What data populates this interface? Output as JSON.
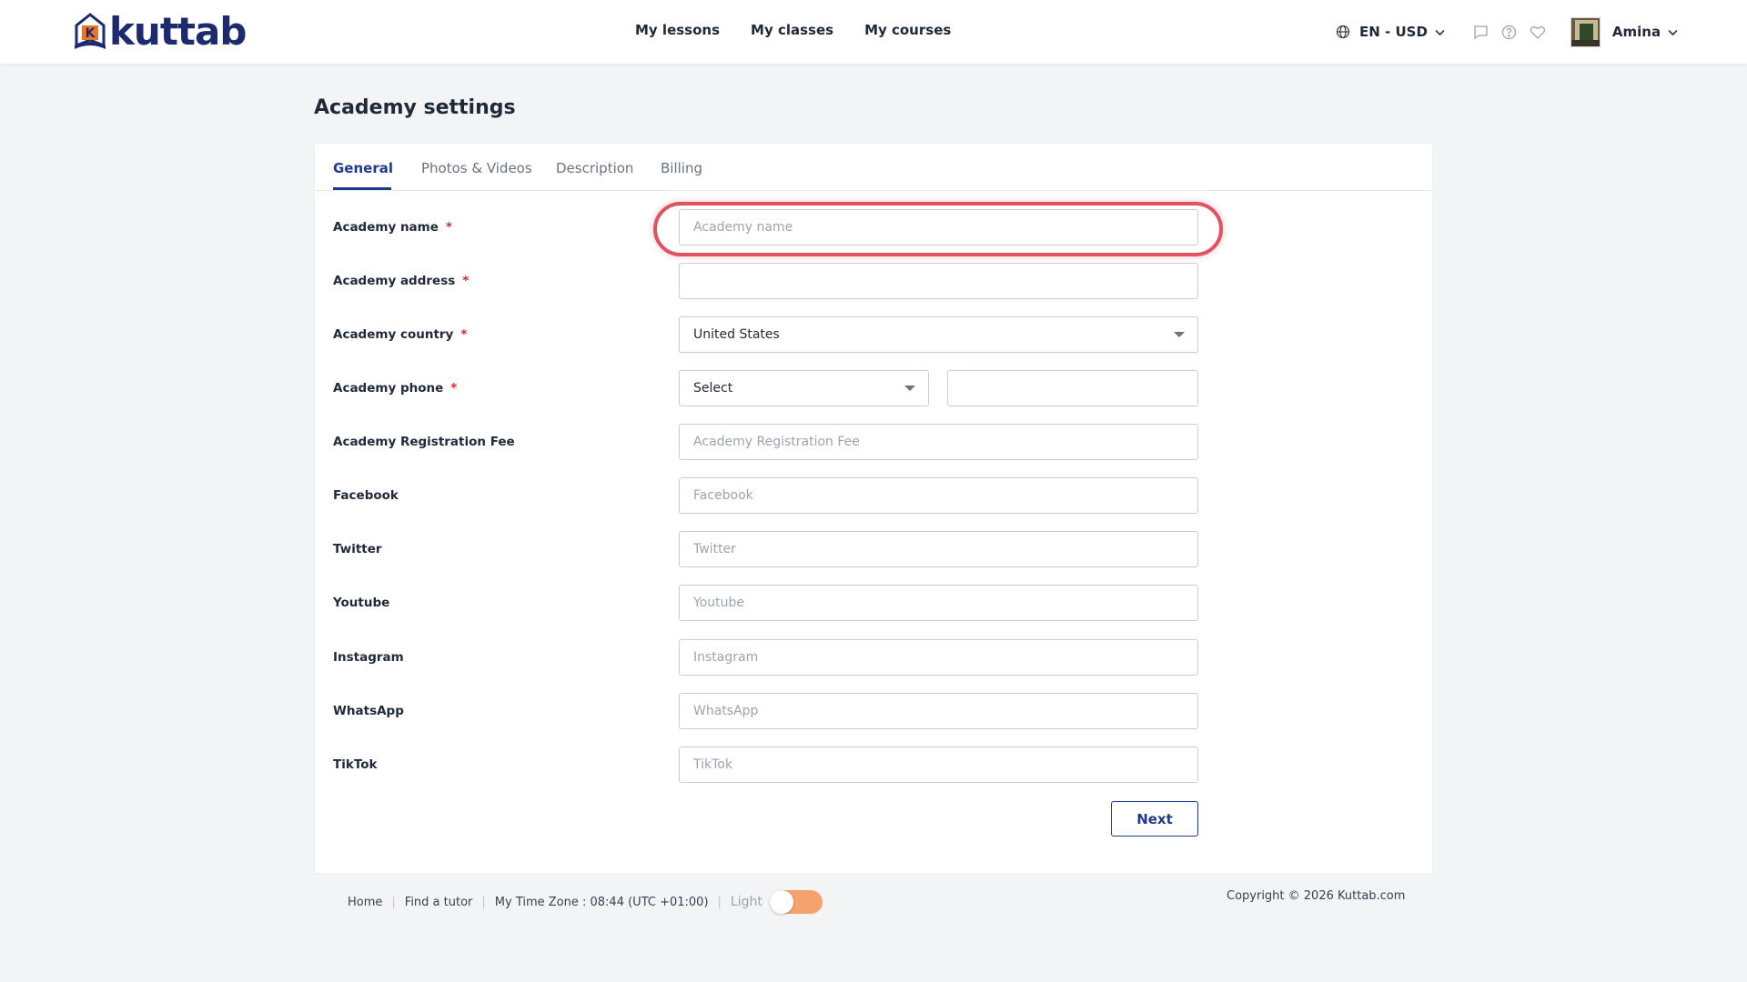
{
  "header": {
    "logo_text": "kuttab",
    "nav": [
      "My lessons",
      "My classes",
      "My courses"
    ],
    "language_currency": "EN - USD",
    "user_name": "Amina"
  },
  "page": {
    "title": "Academy settings"
  },
  "tabs": [
    "General",
    "Photos & Videos",
    "Description",
    "Billing"
  ],
  "form": {
    "academy_name": {
      "label": "Academy name",
      "required": "*",
      "placeholder": "Academy name",
      "value": ""
    },
    "academy_address": {
      "label": "Academy address",
      "required": "*",
      "placeholder": "",
      "value": ""
    },
    "academy_country": {
      "label": "Academy country",
      "required": "*",
      "value": "United States"
    },
    "academy_phone": {
      "label": "Academy phone",
      "required": "*",
      "code_value": "Select",
      "number_value": ""
    },
    "registration_fee": {
      "label": "Academy Registration Fee",
      "placeholder": "Academy Registration Fee"
    },
    "facebook": {
      "label": "Facebook",
      "placeholder": "Facebook"
    },
    "twitter": {
      "label": "Twitter",
      "placeholder": "Twitter"
    },
    "youtube": {
      "label": "Youtube",
      "placeholder": "Youtube"
    },
    "instagram": {
      "label": "Instagram",
      "placeholder": "Instagram"
    },
    "whatsapp": {
      "label": "WhatsApp",
      "placeholder": "WhatsApp"
    },
    "tiktok": {
      "label": "TikTok",
      "placeholder": "TikTok"
    },
    "next_label": "Next"
  },
  "footer": {
    "home": "Home",
    "find_tutor": "Find a tutor",
    "timezone": "My Time Zone : 08:44 (UTC +01:00)",
    "theme_label": "Light",
    "copyright": "Copyright © 2026 Kuttab.com"
  },
  "colors": {
    "brand": "#1e2a6e",
    "accent": "#1e3a8a",
    "required": "#dc2626",
    "highlight": "#e05260",
    "toggle": "#f6a26e"
  }
}
